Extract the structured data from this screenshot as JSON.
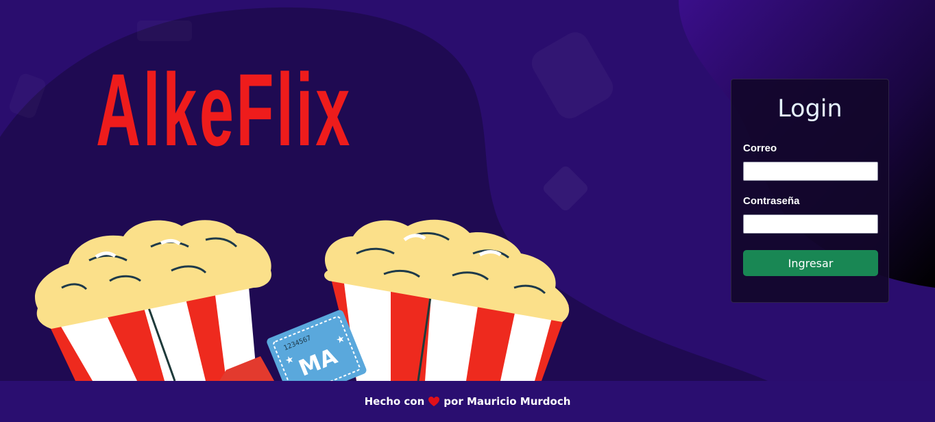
{
  "brand": {
    "title": "AlkeFlix"
  },
  "login": {
    "title": "Login",
    "email_label": "Correo",
    "email_value": "",
    "password_label": "Contraseña",
    "password_value": "",
    "submit_label": "Ingresar"
  },
  "footer": {
    "prefix": "Hecho con",
    "heart_icon": "heart-icon",
    "suffix": "por Mauricio Murdoch"
  },
  "illustration": {
    "ticket_text": "MA",
    "ticket_number": "1234567"
  },
  "colors": {
    "background": "#2a0d6e",
    "blob": "#1f0a52",
    "brand_red": "#ee1c1c",
    "button_green": "#198754",
    "heart": "#e0101a"
  }
}
